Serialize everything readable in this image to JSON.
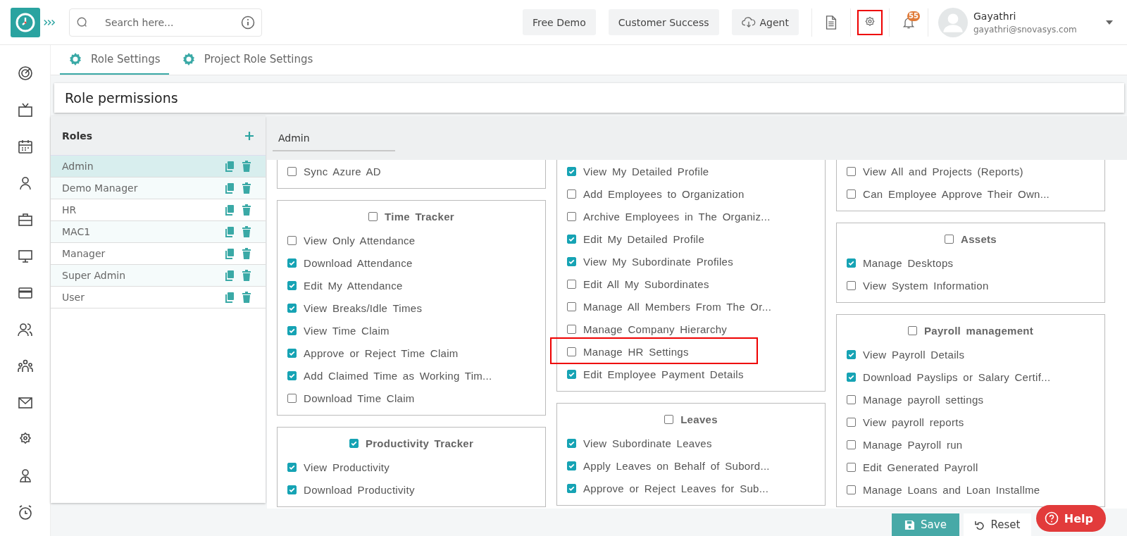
{
  "header": {
    "search": {
      "placeholder": "Search here..."
    },
    "buttons": [
      {
        "label": "Free Demo",
        "kind": "plain"
      },
      {
        "label": "Customer Success",
        "kind": "plain"
      },
      {
        "label": "Agent",
        "kind": "cloud"
      }
    ],
    "tools": [
      {
        "kind": "document",
        "highlighted": false
      },
      {
        "kind": "settings",
        "highlighted": true
      },
      {
        "kind": "bell",
        "badge": "55",
        "highlighted": false
      }
    ],
    "user": {
      "name": "Gayathri",
      "email": "gayathri@snovasys.com"
    }
  },
  "tabs": [
    {
      "label": "Role Settings",
      "selected": true
    },
    {
      "label": "Project Role Settings",
      "selected": false
    }
  ],
  "page_title": "Role permissions",
  "roles": {
    "title": "Roles",
    "items": [
      {
        "name": "Admin",
        "selected": true
      },
      {
        "name": "Demo Manager",
        "selected": false
      },
      {
        "name": "HR",
        "selected": false
      },
      {
        "name": "MAC1",
        "selected": false
      },
      {
        "name": "Manager",
        "selected": false
      },
      {
        "name": "Super Admin",
        "selected": false
      },
      {
        "name": "User",
        "selected": false
      }
    ]
  },
  "selected_role": "Admin",
  "columns": [
    [
      {
        "items": [
          {
            "label": "Sync Azure AD",
            "checked": false,
            "highlighted": false
          }
        ]
      },
      {
        "title": "Time Tracker",
        "checked": false,
        "items": [
          {
            "label": "View Only Attendance",
            "checked": false,
            "highlighted": false
          },
          {
            "label": "Download Attendance",
            "checked": true,
            "highlighted": false
          },
          {
            "label": "Edit My Attendance",
            "checked": true,
            "highlighted": false
          },
          {
            "label": "View Breaks/Idle Times",
            "checked": true,
            "highlighted": false
          },
          {
            "label": "View Time Claim",
            "checked": true,
            "highlighted": false
          },
          {
            "label": "Approve or Reject Time Claim",
            "checked": true,
            "highlighted": false
          },
          {
            "label": "Add Claimed Time as Working Tim...",
            "checked": true,
            "highlighted": false
          },
          {
            "label": "Download Time Claim",
            "checked": false,
            "highlighted": false
          }
        ]
      },
      {
        "title": "Productivity Tracker",
        "checked": true,
        "items": [
          {
            "label": "View Productivity",
            "checked": true,
            "highlighted": false
          },
          {
            "label": "Download Productivity",
            "checked": true,
            "highlighted": false
          }
        ]
      }
    ],
    [
      {
        "items": [
          {
            "label": "View My Detailed Profile",
            "checked": true,
            "highlighted": false
          },
          {
            "label": "Add Employees to Organization",
            "checked": false,
            "highlighted": false
          },
          {
            "label": "Archive Employees in The Organiz...",
            "checked": false,
            "highlighted": false
          },
          {
            "label": "Edit My Detailed Profile",
            "checked": true,
            "highlighted": false
          },
          {
            "label": "View My Subordinate Profiles",
            "checked": true,
            "highlighted": false
          },
          {
            "label": "Edit All My Subordinates",
            "checked": false,
            "highlighted": false
          },
          {
            "label": "Manage All Members From The Or...",
            "checked": false,
            "highlighted": false
          },
          {
            "label": "Manage Company Hierarchy",
            "checked": false,
            "highlighted": false
          },
          {
            "label": "Manage HR Settings",
            "checked": false,
            "highlighted": true
          },
          {
            "label": "Edit Employee Payment Details",
            "checked": true,
            "highlighted": false
          }
        ]
      },
      {
        "title": "Leaves",
        "checked": false,
        "items": [
          {
            "label": "View Subordinate Leaves",
            "checked": true,
            "highlighted": false
          },
          {
            "label": "Apply Leaves on Behalf of Subord...",
            "checked": true,
            "highlighted": false
          },
          {
            "label": "Approve or Reject Leaves for Sub...",
            "checked": true,
            "highlighted": false
          }
        ]
      }
    ],
    [
      {
        "items": [
          {
            "label": "View All and Projects (Reports)",
            "checked": false,
            "highlighted": false
          },
          {
            "label": "Can Employee Approve Their Own...",
            "checked": false,
            "highlighted": false
          }
        ]
      },
      {
        "title": "Assets",
        "checked": false,
        "items": [
          {
            "label": "Manage Desktops",
            "checked": true,
            "highlighted": false
          },
          {
            "label": "View System Information",
            "checked": false,
            "highlighted": false
          }
        ]
      },
      {
        "title": "Payroll management",
        "checked": false,
        "items": [
          {
            "label": "View Payroll Details",
            "checked": true,
            "highlighted": false
          },
          {
            "label": "Download Payslips or Salary Certif...",
            "checked": true,
            "highlighted": false
          },
          {
            "label": "Manage payroll settings",
            "checked": false,
            "highlighted": false
          },
          {
            "label": "View payroll reports",
            "checked": false,
            "highlighted": false
          },
          {
            "label": "Manage Payroll run",
            "checked": false,
            "highlighted": false
          },
          {
            "label": "Edit Generated Payroll",
            "checked": false,
            "highlighted": false
          },
          {
            "label": "Manage Loans and Loan Installme",
            "checked": false,
            "highlighted": false
          }
        ]
      }
    ]
  ],
  "actions": [
    {
      "label": "Save",
      "kind": "primary"
    },
    {
      "label": "Reset",
      "kind": "secondary"
    }
  ],
  "help": "Help"
}
